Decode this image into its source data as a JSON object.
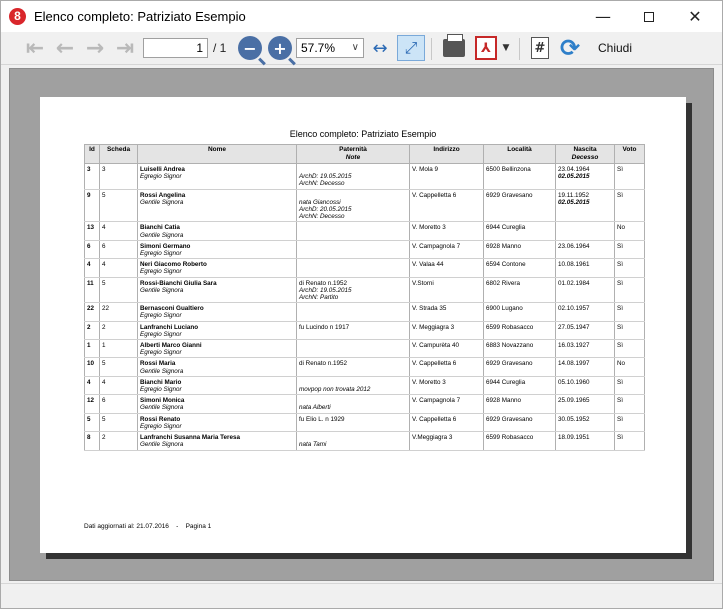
{
  "window": {
    "title": "Elenco completo: Patriziato Esempio",
    "app_icon": "8"
  },
  "toolbar": {
    "page_current": "1",
    "page_total": "/ 1",
    "zoom": "57.7%",
    "close_label": "Chiudi"
  },
  "report": {
    "title": "Elenco completo: Patriziato Esempio",
    "headers": {
      "id": "Id",
      "scheda": "Scheda",
      "nome": "Nome",
      "paternita": "Paternità",
      "note": "Note",
      "indirizzo": "Indirizzo",
      "localita": "Località",
      "nascita": "Nascita",
      "decesso": "Decesso",
      "voto": "Voto"
    },
    "rows": [
      {
        "id": "3",
        "scheda": "3",
        "name": "Luiselli Andrea",
        "title": "Egregio Signor",
        "pat": [
          "",
          "ArchD: 19.05.2015",
          "ArchN: Decesso"
        ],
        "addr": "V. Mola 9",
        "loc": "6500 Bellinzona",
        "birth": "23.04.1964",
        "death": "02.05.2015",
        "voto": "Sì"
      },
      {
        "id": "9",
        "scheda": "5",
        "name": "Rossi Angelina",
        "title": "Gentile Signora",
        "pat": [
          "",
          "nata Giancossi",
          "ArchD: 20.05.2015",
          "ArchN: Decesso"
        ],
        "addr": "V. Cappelletta 6",
        "loc": "6929 Gravesano",
        "birth": "19.11.1952",
        "death": "02.05.2015",
        "voto": "Sì"
      },
      {
        "id": "13",
        "scheda": "4",
        "name": "Bianchi Catia",
        "title": "Gentile Signora",
        "pat": [],
        "addr": "V. Moretto 3",
        "loc": "6944 Cureglia",
        "birth": "",
        "death": "",
        "voto": "No"
      },
      {
        "id": "6",
        "scheda": "6",
        "name": "Simoni Germano",
        "title": "Egregio Signor",
        "pat": [],
        "addr": "V. Campagnola 7",
        "loc": "6928 Manno",
        "birth": "23.06.1964",
        "death": "",
        "voto": "Sì"
      },
      {
        "id": "4",
        "scheda": "4",
        "name": "Neri Giacomo Roberto",
        "title": "Egregio Signor",
        "pat": [],
        "addr": "V. Valaa 44",
        "loc": "6594 Contone",
        "birth": "10.08.1961",
        "death": "",
        "voto": "Sì"
      },
      {
        "id": "11",
        "scheda": "5",
        "name": "Rossi-Bianchi Giulia Sara",
        "title": "Gentile Signora",
        "pat": [
          "di Renato  n.1952",
          "ArchD: 19.05.2015",
          "ArchN: Partito"
        ],
        "addr": "V.Storni",
        "loc": "6802 Rivera",
        "birth": "01.02.1984",
        "death": "",
        "voto": "Sì"
      },
      {
        "id": "22",
        "scheda": "22",
        "name": "Bernasconi Gualtiero",
        "title": "Egregio Signor",
        "pat": [],
        "addr": "V. Strada 35",
        "loc": "6900 Lugano",
        "birth": "02.10.1957",
        "death": "",
        "voto": "Sì"
      },
      {
        "id": "2",
        "scheda": "2",
        "name": "Lanfranchi Luciano",
        "title": "Egregio Signor",
        "pat": [
          "fu Lucindo n 1917"
        ],
        "addr": "V. Meggiagra 3",
        "loc": "6599 Robasacco",
        "birth": "27.05.1947",
        "death": "",
        "voto": "Sì"
      },
      {
        "id": "1",
        "scheda": "1",
        "name": "Alberti Marco Gianni",
        "title": "Egregio Signor",
        "pat": [],
        "addr": "V. Campurèta 40",
        "loc": "6883 Novazzano",
        "birth": "16.03.1927",
        "death": "",
        "voto": "Sì"
      },
      {
        "id": "10",
        "scheda": "5",
        "name": "Rossi Maria",
        "title": "Gentile Signora",
        "pat": [
          "di Renato  n.1952"
        ],
        "addr": "V. Cappelletta 6",
        "loc": "6929 Gravesano",
        "birth": "14.08.1997",
        "death": "",
        "voto": "No"
      },
      {
        "id": "4",
        "scheda": "4",
        "name": "Bianchi Mario",
        "title": "Egregio Signor",
        "pat": [
          "",
          "movpop non trovata 2012"
        ],
        "addr": "V. Moretto 3",
        "loc": "6944 Cureglia",
        "birth": "05.10.1960",
        "death": "",
        "voto": "Sì"
      },
      {
        "id": "12",
        "scheda": "6",
        "name": "Simoni Monica",
        "title": "Gentile Signora",
        "pat": [
          "",
          "nata Alberti"
        ],
        "addr": "V. Campagnola 7",
        "loc": "6928 Manno",
        "birth": "25.09.1965",
        "death": "",
        "voto": "Sì"
      },
      {
        "id": "5",
        "scheda": "5",
        "name": "Rossi Renato",
        "title": "Egregio Signor",
        "pat": [
          "fu Elio L. n 1929"
        ],
        "addr": "V. Cappelletta 6",
        "loc": "6929 Gravesano",
        "birth": "30.05.1952",
        "death": "",
        "voto": "Sì"
      },
      {
        "id": "8",
        "scheda": "2",
        "name": "Lanfranchi Susanna Maria Teresa",
        "title": "Gentile Signora",
        "pat": [
          "",
          "nata Tami"
        ],
        "addr": "V.Meggiagra 3",
        "loc": "6599 Robasacco",
        "birth": "18.09.1951",
        "death": "",
        "voto": "Sì"
      }
    ],
    "footer_date": "Dati aggiornati al: 21.07.2016",
    "footer_sep": "-",
    "footer_page": "Pagina 1"
  },
  "colors": {
    "viewport_bg": "#a0a0a0",
    "active_button": "#cce4f7",
    "pdf_red": "#c62828",
    "accent_blue": "#2d6bb5"
  },
  "icons": [
    "app-icon",
    "first-page-icon",
    "prev-page-icon",
    "next-page-icon",
    "last-page-icon",
    "zoom-out-icon",
    "zoom-in-icon",
    "fit-width-icon",
    "fit-page-icon",
    "printer-icon",
    "pdf-icon",
    "dropdown-icon",
    "page-number-icon",
    "refresh-icon",
    "minimize-icon",
    "maximize-icon",
    "close-icon"
  ]
}
